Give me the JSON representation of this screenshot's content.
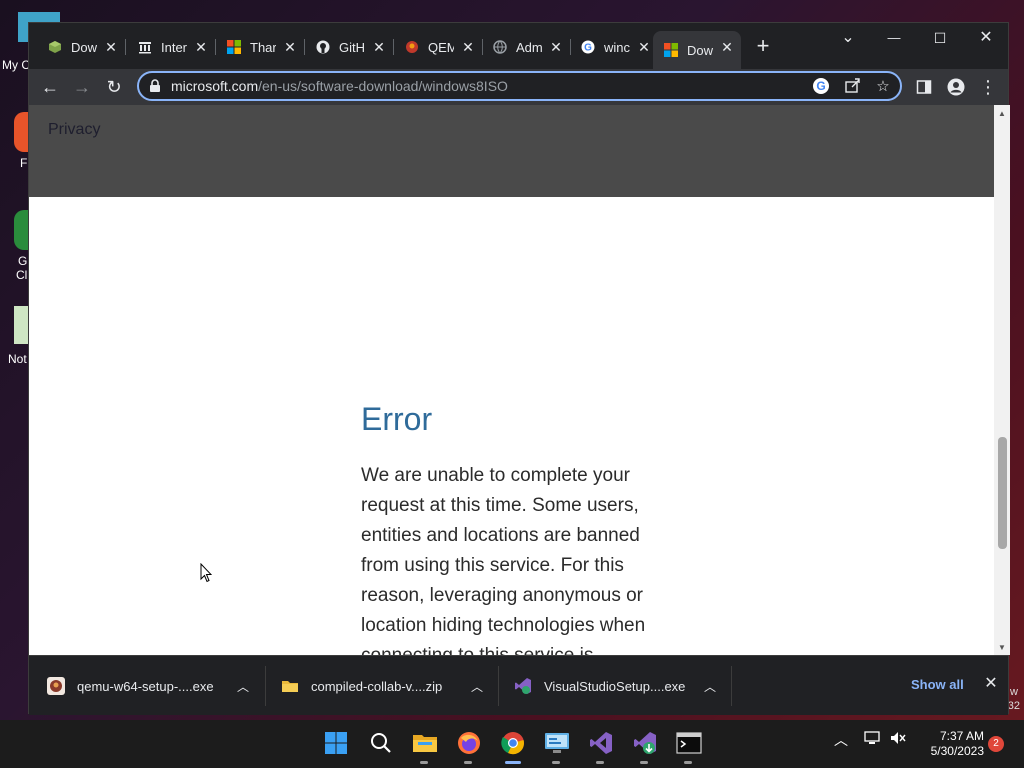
{
  "desktop": {
    "labels": [
      "My C",
      "F",
      "G",
      "Cl",
      "Not"
    ],
    "right_text": [
      "w",
      "32"
    ]
  },
  "browser": {
    "tabs": [
      {
        "title": "Dow",
        "icon": "box-icon",
        "color": "#6a8f3a"
      },
      {
        "title": "Inter",
        "icon": "archive-icon",
        "color": "#e8eaed"
      },
      {
        "title": "Thar",
        "icon": "microsoft-icon",
        "color": "#f25022"
      },
      {
        "title": "GitH",
        "icon": "github-icon",
        "color": "#e8eaed"
      },
      {
        "title": "QEM",
        "icon": "qemu-icon",
        "color": "#c0392b"
      },
      {
        "title": "Adm",
        "icon": "globe-icon",
        "color": "#9aa0a6"
      },
      {
        "title": "winc",
        "icon": "google-icon",
        "color": "#4285f4"
      },
      {
        "title": "Dow",
        "icon": "microsoft-icon",
        "color": "#f25022",
        "active": true
      }
    ],
    "window_controls": {
      "tab_search": "⌄",
      "minimize": "—",
      "maximize": "☐",
      "close": "✕"
    },
    "toolbar": {
      "back": "←",
      "forward": "→",
      "reload": "↻",
      "url_host": "microsoft.com",
      "url_path": "/en-us/software-download/windows8ISO"
    }
  },
  "page": {
    "footer_link": "Privacy",
    "error_title": "Error",
    "error_body": "We are unable to complete your request at this time. Some users, entities and locations are banned from using this service. For this reason, leveraging anonymous or location hiding technologies when connecting to this service is"
  },
  "downloads": {
    "items": [
      {
        "name": "qemu-w64-setup-....exe",
        "icon": "qemu-icon"
      },
      {
        "name": "compiled-collab-v....zip",
        "icon": "folder-zip-icon"
      },
      {
        "name": "VisualStudioSetup....exe",
        "icon": "visual-studio-icon"
      }
    ],
    "show_all": "Show all",
    "close": "✕"
  },
  "taskbar": {
    "apps": [
      "start",
      "search",
      "file-explorer",
      "firefox",
      "chrome",
      "control-panel",
      "visual-studio",
      "visual-studio-installer",
      "terminal"
    ],
    "time": "7:37 AM",
    "date": "5/30/2023",
    "notifications": "2"
  },
  "colors": {
    "accent": "#8ab4f8",
    "error_title": "#2f6b9a",
    "chrome_dark": "#202124",
    "chrome_toolbar": "#35363a"
  }
}
